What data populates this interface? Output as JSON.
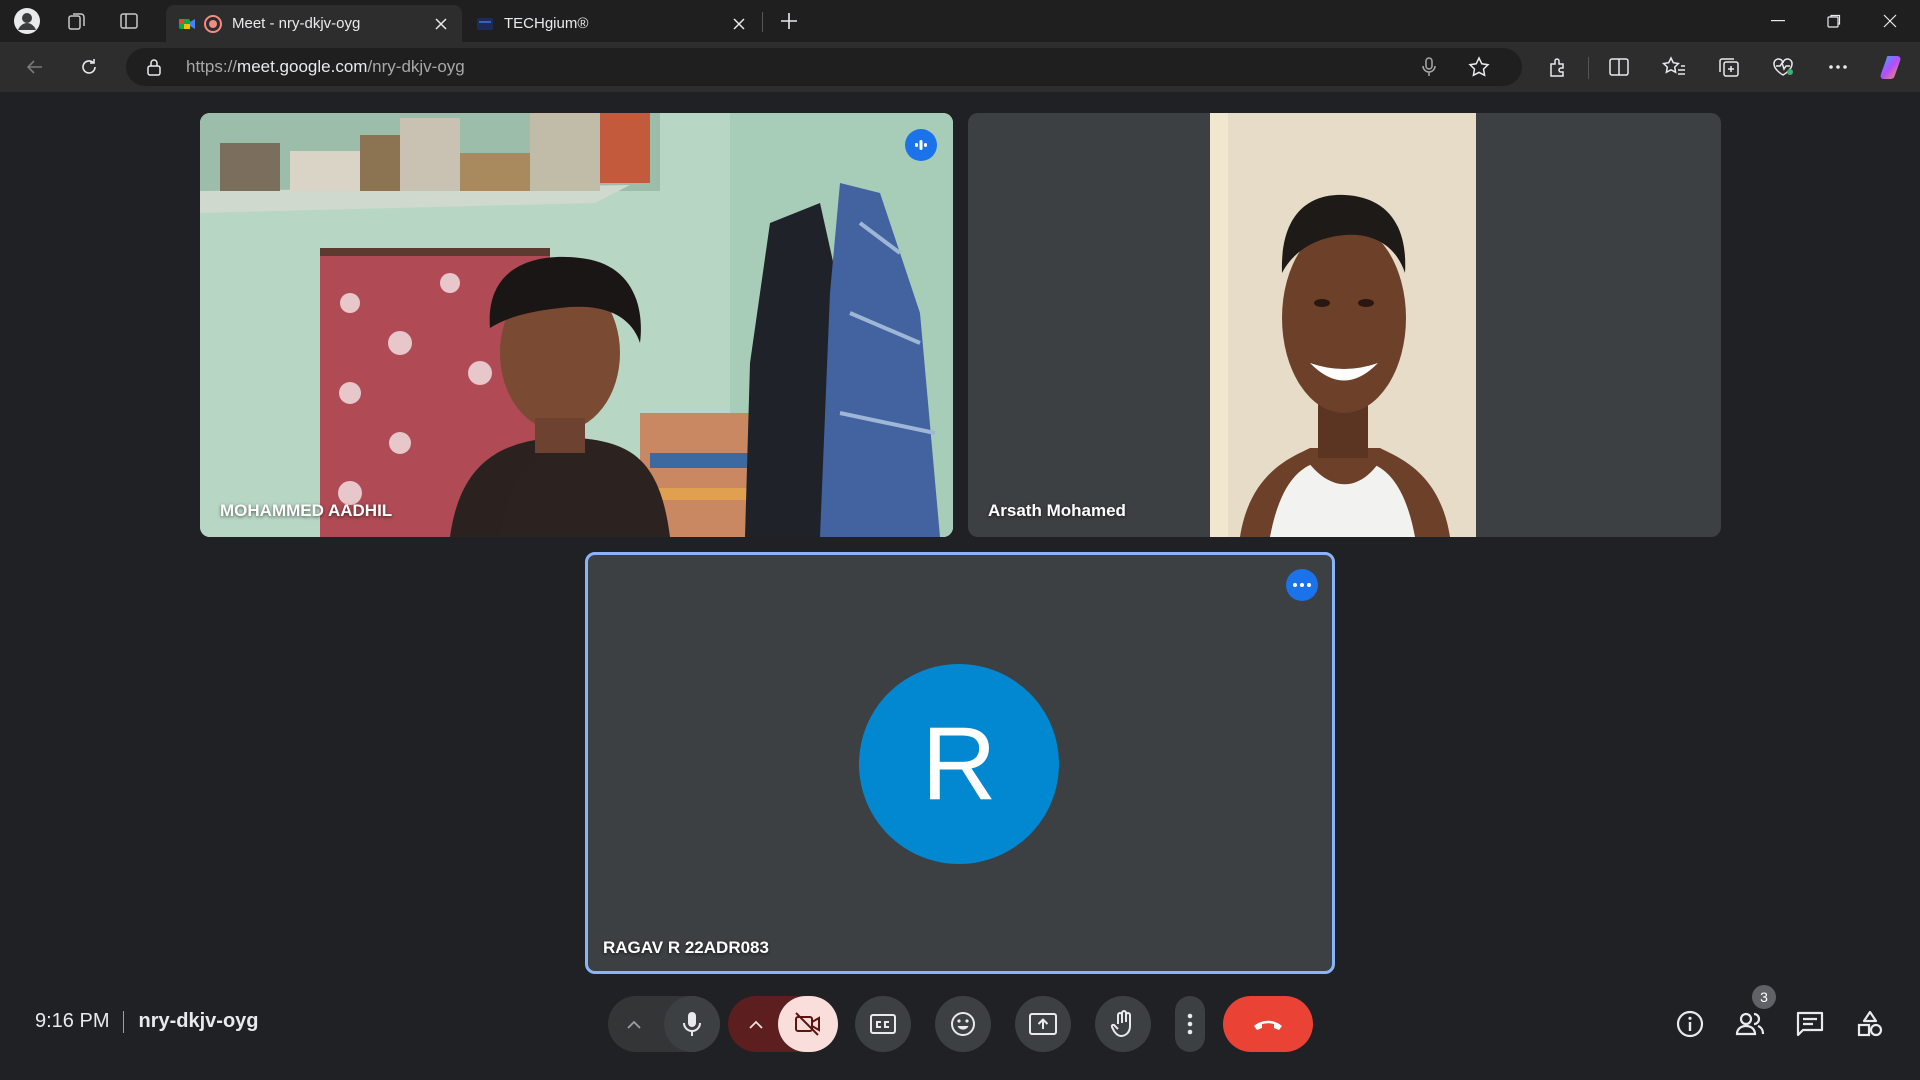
{
  "browser": {
    "tabs": [
      {
        "title": "Meet - nry-dkjv-oyg",
        "active": true,
        "favicon": "google-meet-icon",
        "recording": true
      },
      {
        "title": "TECHgium®",
        "active": false,
        "favicon": "techgium-icon"
      }
    ],
    "url_scheme": "https://",
    "url_host": "meet.google.com",
    "url_path": "/nry-dkjv-oyg"
  },
  "participants": [
    {
      "name": "MOHAMMED AADHIL",
      "video": true,
      "speaking": true
    },
    {
      "name": "Arsath Mohamed",
      "video": true
    },
    {
      "name": "RAGAV R 22ADR083",
      "video": false,
      "avatar_letter": "R",
      "avatar_color": "#0288d1",
      "pinned_highlight": true
    }
  ],
  "meeting": {
    "time": "9:16 PM",
    "code": "nry-dkjv-oyg",
    "participant_count": "3"
  },
  "colors": {
    "background": "#202124",
    "tile": "#3c4043",
    "accent": "#1a73e8",
    "leave": "#ea4335",
    "camera_off_bg": "#f9dedc"
  },
  "controls": [
    "audio-options-chevron",
    "microphone-icon",
    "video-options-chevron",
    "camera-off-icon",
    "captions-icon",
    "emoji-icon",
    "present-icon",
    "raise-hand-icon",
    "more-options-icon",
    "leave-call-icon"
  ],
  "side_controls": [
    "info-icon",
    "people-icon",
    "chat-icon",
    "activities-icon"
  ]
}
